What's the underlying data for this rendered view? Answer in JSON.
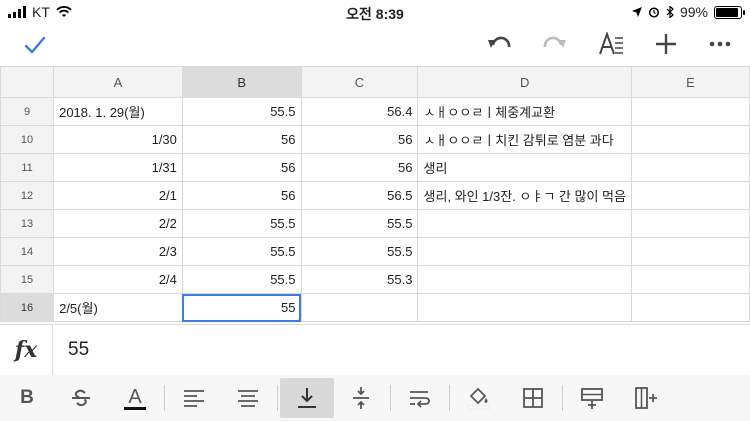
{
  "status": {
    "carrier": "KT",
    "time": "오전 8:39",
    "battery": "99%",
    "battery_level": 0.99
  },
  "toolbar": {
    "icons": [
      "check-icon",
      "undo-icon",
      "redo-icon",
      "text-format-icon",
      "add-icon",
      "more-icon"
    ]
  },
  "grid": {
    "columns": [
      "A",
      "B",
      "C",
      "D",
      "E"
    ],
    "rows": [
      {
        "n": "9",
        "a": "2018. 1. 29(월)",
        "b": "55.5",
        "c": "56.4",
        "d": "ㅅㅐㅇㅇㄹㅣ체중계교환",
        "e": ""
      },
      {
        "n": "10",
        "a": "1/30",
        "b": "56",
        "c": "56",
        "d": "ㅅㅐㅇㅇㄹㅣ치킨 감튀로 염분 과다",
        "e": ""
      },
      {
        "n": "11",
        "a": "1/31",
        "b": "56",
        "c": "56",
        "d": "생리",
        "e": ""
      },
      {
        "n": "12",
        "a": "2/1",
        "b": "56",
        "c": "56.5",
        "d": "생리, 와인 1/3잔. ㅇㅑㄱ 간 많이 먹음",
        "e": ""
      },
      {
        "n": "13",
        "a": "2/2",
        "b": "55.5",
        "c": "55.5",
        "d": "",
        "e": ""
      },
      {
        "n": "14",
        "a": "2/3",
        "b": "55.5",
        "c": "55.5",
        "d": "",
        "e": ""
      },
      {
        "n": "15",
        "a": "2/4",
        "b": "55.5",
        "c": "55.3",
        "d": "",
        "e": ""
      },
      {
        "n": "16",
        "a": "2/5(월)",
        "b": "55",
        "c": "",
        "d": "",
        "e": ""
      }
    ]
  },
  "formula_bar": {
    "label": "fx",
    "value": "55"
  },
  "format_bar": {
    "buttons": [
      "bold",
      "strikethrough",
      "text-color",
      "align-left",
      "align-center",
      "valign-bottom",
      "valign-middle",
      "wrap",
      "fill-color",
      "borders",
      "insert-row",
      "insert-column"
    ],
    "bold_label": "B",
    "text_color_label": "A",
    "active": "valign-bottom"
  }
}
